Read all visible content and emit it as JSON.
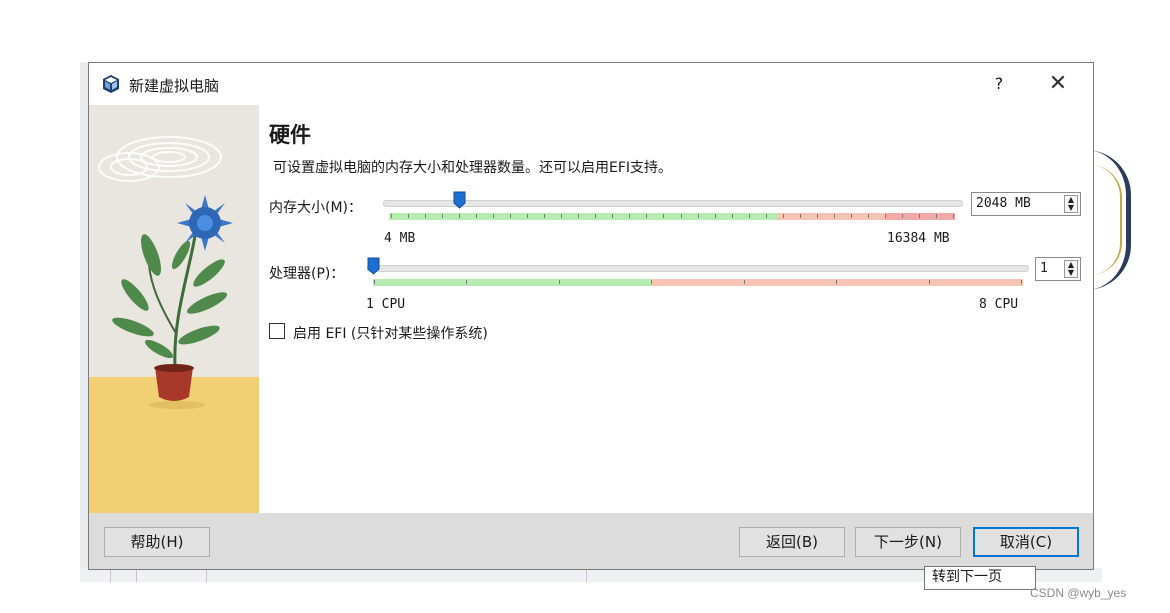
{
  "window": {
    "title": "新建虚拟电脑",
    "help_button": "?",
    "close_button": "✕"
  },
  "page": {
    "heading": "硬件",
    "description": "可设置虚拟电脑的内存大小和处理器数量。还可以启用EFI支持。"
  },
  "memory": {
    "label": "内存大小(M)：",
    "value_text": "2048 MB",
    "value_mb": 2048,
    "min_label": "4 MB",
    "max_label": "16384 MB"
  },
  "processor": {
    "label": "处理器(P)：",
    "value_text": "1",
    "value": 1,
    "min_label": "1 CPU",
    "max_label": "8 CPU"
  },
  "efi": {
    "label": "启用 EFI (只针对某些操作系统)",
    "checked": false
  },
  "footer": {
    "help_label": "帮助(H)",
    "back_label": "返回(B)",
    "next_label": "下一步(N)",
    "cancel_label": "取消(C)"
  },
  "tooltip": "转到下一页",
  "watermark": "CSDN @wyb_yes",
  "colors": {
    "green_zone": "#b6ecb0",
    "orange_zone": "#f6c4b2",
    "red_zone": "#f3a9a9",
    "accent": "#0078d7"
  }
}
